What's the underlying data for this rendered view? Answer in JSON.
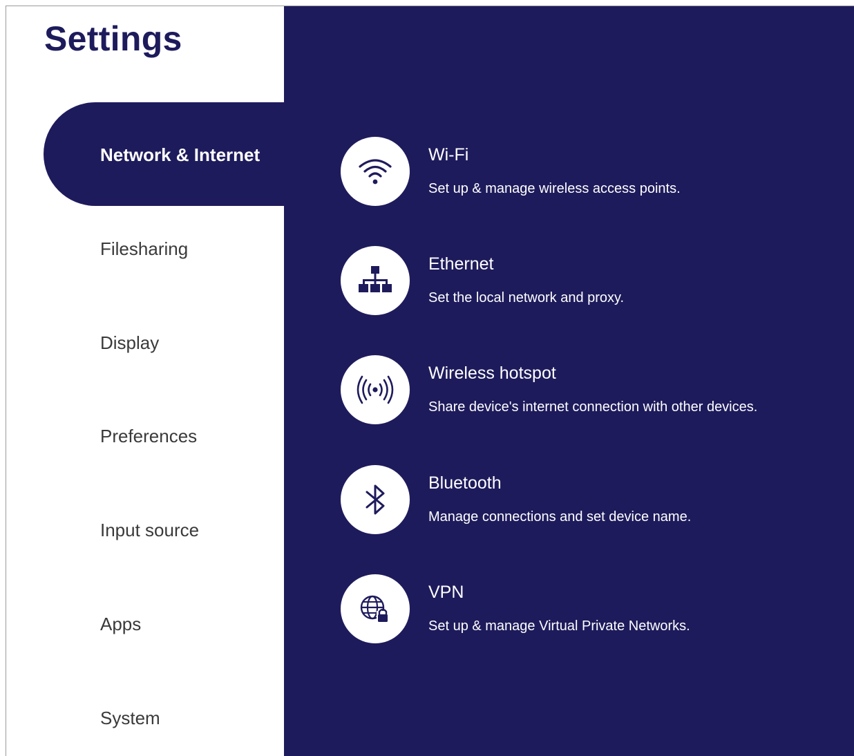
{
  "header": {
    "title": "Settings"
  },
  "sidebar": {
    "active_label": "Network & Internet",
    "items": [
      {
        "label": "Filesharing"
      },
      {
        "label": "Display"
      },
      {
        "label": "Preferences"
      },
      {
        "label": "Input source"
      },
      {
        "label": "Apps"
      },
      {
        "label": "System"
      }
    ]
  },
  "main": {
    "items": [
      {
        "title": "Wi-Fi",
        "description": "Set up & manage wireless access points.",
        "icon": "wifi-icon"
      },
      {
        "title": "Ethernet",
        "description": "Set the local network and proxy.",
        "icon": "ethernet-icon"
      },
      {
        "title": "Wireless hotspot",
        "description": "Share device's internet connection with other devices.",
        "icon": "hotspot-icon"
      },
      {
        "title": "Bluetooth",
        "description": "Manage connections and set device name.",
        "icon": "bluetooth-icon"
      },
      {
        "title": "VPN",
        "description": "Set up & manage Virtual Private Networks.",
        "icon": "vpn-icon"
      }
    ]
  },
  "colors": {
    "primary_navy": "#1e1b5c",
    "background": "#ffffff",
    "nav_text": "#3a3a3a"
  }
}
